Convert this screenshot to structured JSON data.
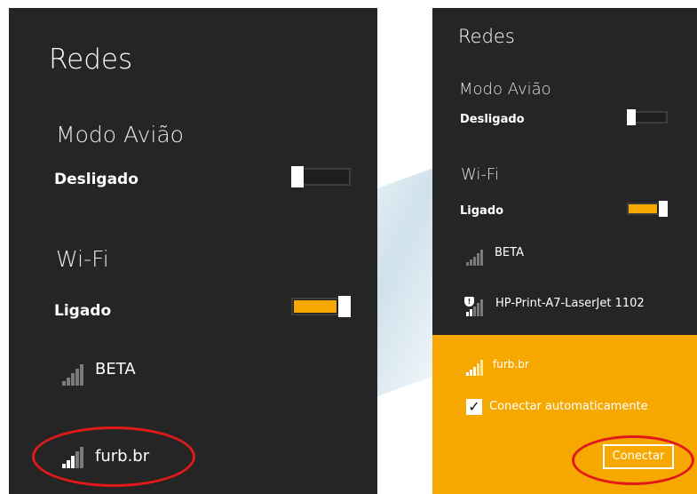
{
  "left": {
    "title": "Redes",
    "airplane": {
      "heading": "Modo Avião",
      "state": "Desligado",
      "on": false
    },
    "wifi": {
      "heading": "Wi-Fi",
      "state": "Ligado",
      "on": true
    },
    "networks": [
      {
        "name": "BETA",
        "icon": "wifi-signal-icon"
      },
      {
        "name": "furb.br",
        "icon": "wifi-signal-icon"
      }
    ]
  },
  "right": {
    "title": "Redes",
    "airplane": {
      "heading": "Modo Avião",
      "state": "Desligado",
      "on": false
    },
    "wifi": {
      "heading": "Wi-Fi",
      "state": "Ligado",
      "on": true
    },
    "networks": [
      {
        "name": "BETA",
        "icon": "wifi-signal-icon"
      },
      {
        "name": "HP-Print-A7-LaserJet 1102",
        "icon": "secured-wifi-signal-icon"
      },
      {
        "name": "furb.br",
        "icon": "wifi-signal-icon",
        "selected": true
      }
    ],
    "auto_connect_label": "Conectar automaticamente",
    "auto_connect_checked": true,
    "connect_button": "Conectar"
  },
  "colors": {
    "panel": "#252525",
    "accent": "#f7a800",
    "highlight": "#e01919"
  }
}
